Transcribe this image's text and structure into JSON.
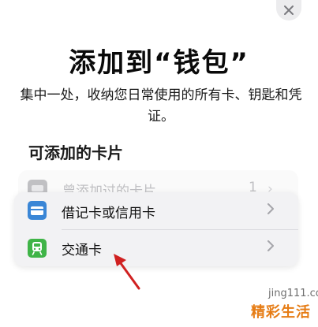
{
  "header": {
    "close_icon": "close-icon",
    "title": "添加到“钱包”",
    "subtitle": "集中一处，收纳您日常使用的所有卡、钥匙和凭证。"
  },
  "available_cards": {
    "section_title": "可添加的卡片",
    "previous": {
      "label": "曾添加过的卡片",
      "count": "1",
      "icon": "card-stack-icon"
    },
    "items": [
      {
        "label": "借记卡或信用卡",
        "icon": "credit-card-icon"
      },
      {
        "label": "交通卡",
        "icon": "transit-icon"
      }
    ]
  },
  "annotation": {
    "arrow_color": "#d02020"
  },
  "watermark": {
    "url": "jing111.com",
    "site_name": "精彩生活",
    "color": "#e67c14"
  }
}
